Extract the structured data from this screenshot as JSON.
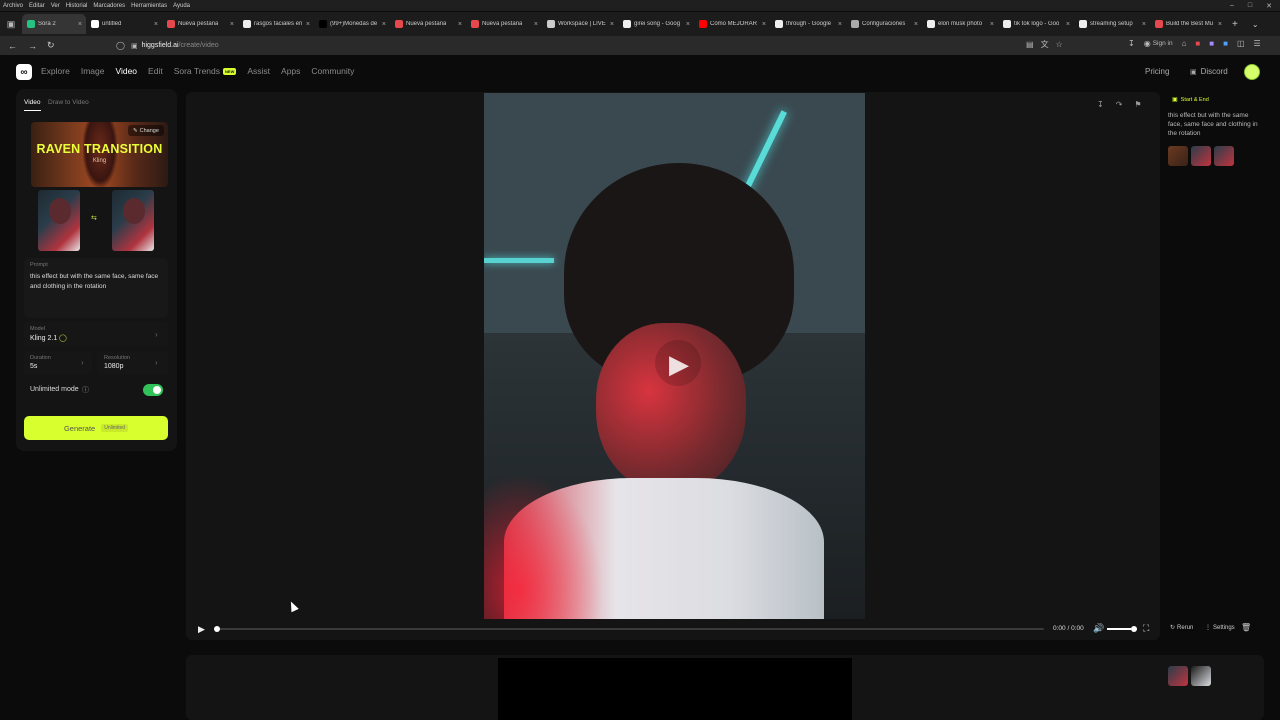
{
  "os_menu": [
    "Archivo",
    "Editar",
    "Ver",
    "Historial",
    "Marcadores",
    "Herramientas",
    "Ayuda"
  ],
  "browser": {
    "tabs": [
      {
        "title": "Sora 2",
        "color": "#23c483",
        "active": true
      },
      {
        "title": "untitled",
        "color": "#ffffff",
        "active": false
      },
      {
        "title": "Nueva pestaña",
        "color": "#e5484d",
        "active": false
      },
      {
        "title": "rasgos faciales en",
        "color": "#eeeeee",
        "active": false
      },
      {
        "title": "(99+)Monedas de",
        "color": "#000000",
        "active": false
      },
      {
        "title": "Nueva pestaña",
        "color": "#e5484d",
        "active": false
      },
      {
        "title": "Nueva pestaña",
        "color": "#e5484d",
        "active": false
      },
      {
        "title": "Workspace | LIVE",
        "color": "#cccccc",
        "active": false
      },
      {
        "title": "girei song - Goog",
        "color": "#eeeeee",
        "active": false
      },
      {
        "title": "Cómo MEJORAR",
        "color": "#ff0000",
        "active": false
      },
      {
        "title": "through - Google",
        "color": "#eeeeee",
        "active": false
      },
      {
        "title": "Configuraciones",
        "color": "#aaaaaa",
        "active": false
      },
      {
        "title": "elon musk photo",
        "color": "#eeeeee",
        "active": false
      },
      {
        "title": "tik tok logo - Goo",
        "color": "#eeeeee",
        "active": false
      },
      {
        "title": "streaming setup",
        "color": "#eeeeee",
        "active": false
      },
      {
        "title": "Build the Best Mu",
        "color": "#e5484d",
        "active": false
      }
    ],
    "url_host": "higgsfield.ai",
    "url_path": "/create/video",
    "sign_in": "Sign in"
  },
  "site": {
    "nav": [
      {
        "label": "Explore",
        "active": false
      },
      {
        "label": "Image",
        "active": false
      },
      {
        "label": "Video",
        "active": true
      },
      {
        "label": "Edit",
        "active": false
      },
      {
        "label": "Sora Trends",
        "active": false
      },
      {
        "label": "Assist",
        "active": false
      },
      {
        "label": "Apps",
        "active": false
      },
      {
        "label": "Community",
        "active": false
      }
    ],
    "new_badge": "NEW",
    "pricing": "Pricing",
    "discord": "Discord"
  },
  "left": {
    "tabs": [
      "Video",
      "Draw to Video"
    ],
    "effect_title": "RAVEN TRANSITION",
    "effect_sub": "Kling",
    "change": "Change",
    "prompt_label": "Prompt",
    "prompt_text": "this effect but with the same face, same face and clothing in the rotation",
    "model_label": "Model",
    "model_value": "Kling 2.1",
    "duration_label": "Duration",
    "duration_value": "5s",
    "resolution_label": "Resolution",
    "resolution_value": "1080p",
    "unlimited_label": "Unlimited mode",
    "generate": "Generate",
    "generate_badge": "Unlimited"
  },
  "player": {
    "time": "0:00 / 0:00",
    "rerun": "Rerun",
    "settings": "Settings",
    "volume": 0.8,
    "progress": 0
  },
  "right": {
    "tag": "Start & End",
    "prompt": "this effect but with the same face, same face and clothing in the rotation"
  },
  "colors": {
    "accent": "#d8ff2e",
    "toggle": "#32c25a"
  }
}
